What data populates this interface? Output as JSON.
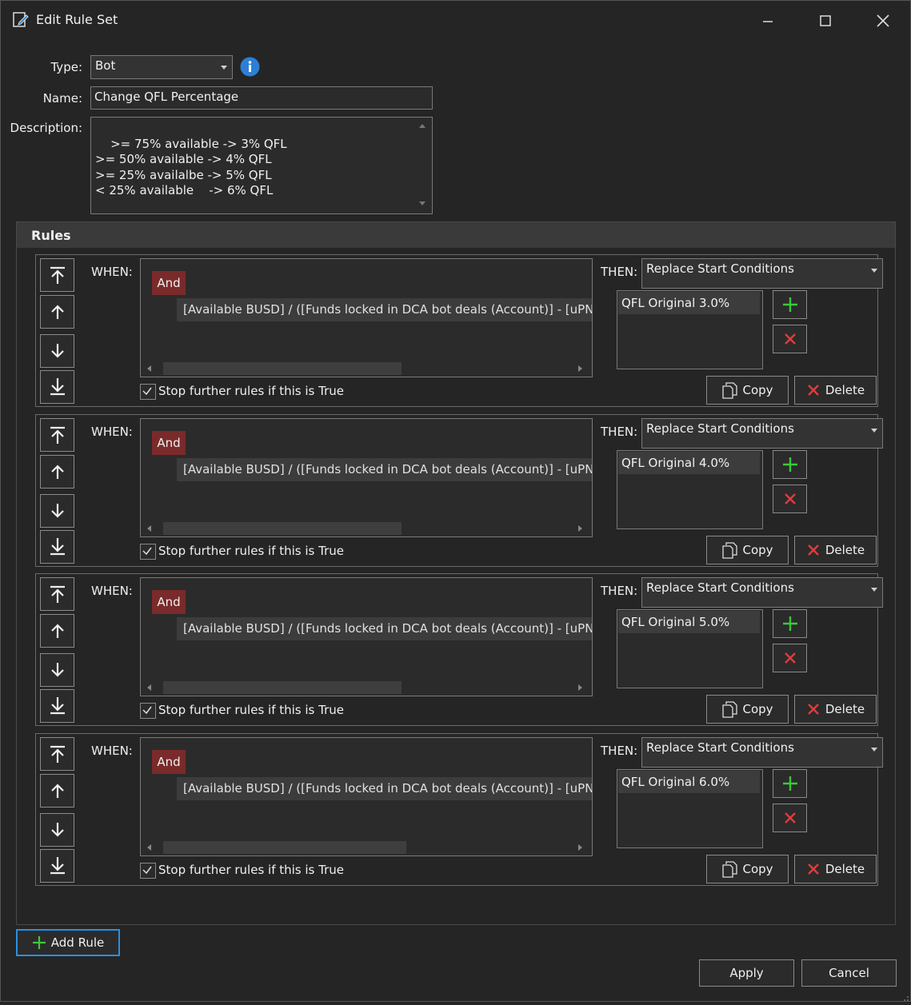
{
  "window": {
    "title": "Edit Rule Set",
    "controls": [
      "minimize",
      "maximize",
      "close"
    ]
  },
  "form": {
    "type_label": "Type:",
    "type_value": "Bot",
    "name_label": "Name:",
    "name_value": "Change QFL Percentage",
    "description_label": "Description:",
    "description_value": ">= 75% available -> 3% QFL\n>= 50% available -> 4% QFL\n>= 25% availalbe -> 5% QFL\n< 25% available    -> 6% QFL"
  },
  "rules_section": {
    "header": "Rules",
    "rules": [
      {
        "when_label": "WHEN:",
        "operator": "And",
        "condition": "[Available BUSD] / ([Funds locked in DCA bot deals (Account)] - [uPNL of all DCA bot deals]",
        "stop_label": "Stop further rules if this is True",
        "stop_checked": true,
        "then_label": "THEN:",
        "action": "Replace Start Conditions",
        "items": [
          "QFL Original 3.0%"
        ],
        "copy_label": "Copy",
        "delete_label": "Delete"
      },
      {
        "when_label": "WHEN:",
        "operator": "And",
        "condition": "[Available BUSD] / ([Funds locked in DCA bot deals (Account)] - [uPNL of all DCA bot deals]",
        "stop_label": "Stop further rules if this is True",
        "stop_checked": true,
        "then_label": "THEN:",
        "action": "Replace Start Conditions",
        "items": [
          "QFL Original 4.0%"
        ],
        "copy_label": "Copy",
        "delete_label": "Delete"
      },
      {
        "when_label": "WHEN:",
        "operator": "And",
        "condition": "[Available BUSD] / ([Funds locked in DCA bot deals (Account)] - [uPNL of all DCA bot deals]",
        "stop_label": "Stop further rules if this is True",
        "stop_checked": true,
        "then_label": "THEN:",
        "action": "Replace Start Conditions",
        "items": [
          "QFL Original 5.0%"
        ],
        "copy_label": "Copy",
        "delete_label": "Delete"
      },
      {
        "when_label": "WHEN:",
        "operator": "And",
        "condition": "[Available BUSD] / ([Funds locked in DCA bot deals (Account)] - [uPNL of all DCA bot deals]",
        "stop_label": "Stop further rules if this is True",
        "stop_checked": true,
        "then_label": "THEN:",
        "action": "Replace Start Conditions",
        "items": [
          "QFL Original 6.0%"
        ],
        "copy_label": "Copy",
        "delete_label": "Delete"
      }
    ]
  },
  "footer": {
    "add_rule_label": "Add Rule",
    "apply_label": "Apply",
    "cancel_label": "Cancel"
  },
  "colors": {
    "background": "#252526",
    "operator_badge": "#7a2a2a",
    "add_green": "#3cc83c",
    "remove_red": "#e03c3c",
    "info_blue": "#2d7fd3",
    "focus_blue": "#2a8fe0"
  }
}
